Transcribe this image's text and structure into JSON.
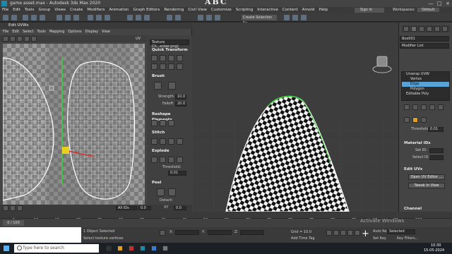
{
  "titlebar": {
    "title": "game asset.max - Autodesk 3ds Max 2020",
    "overlay_letters": "ABC",
    "min": "—",
    "max": "□",
    "close": "×"
  },
  "menu": [
    "File",
    "Edit",
    "Tools",
    "Group",
    "Views",
    "Create",
    "Modifiers",
    "Animation",
    "Graph Editors",
    "Rendering",
    "Civil View",
    "Customize",
    "Scripting",
    "Interactive",
    "Content",
    "Arnold",
    "Help",
    "Sign In"
  ],
  "signin": "Sign In",
  "workspaces": {
    "label": "Workspaces:",
    "value": "Default"
  },
  "toolbar": {
    "selection_set": "Create Selection Se"
  },
  "uvw": {
    "title": "Edit UVWs",
    "menu": [
      "File",
      "Edit",
      "Select",
      "Tools",
      "Mapping",
      "Options",
      "Display",
      "View"
    ],
    "uv_label": "UV",
    "texture_dropdown": "Texture Ch...ecker.png)",
    "sections": {
      "quick_transform": "Quick Transform",
      "brush": "Brush",
      "reshape": "Reshape Elements",
      "stitch": "Stitch",
      "explode": "Explode",
      "peel": "Peel"
    },
    "strength_label": "Strength:",
    "strength_value": "10.0",
    "falloff_label": "Falloff:",
    "falloff_value": "20.0",
    "threshold_label": "Threshold:",
    "threshold_value": "0.01",
    "detach_label": "Detach",
    "bottom": {
      "all_ids": "All IDs",
      "xy": "XY",
      "u_value": "0.0",
      "v_value": "0.0"
    }
  },
  "command_panel": {
    "object_name": "Box001",
    "modifier_list": "Modifier List",
    "stack": [
      "Unwrap UVW",
      "Vertex",
      "Edge",
      "Polygon",
      "Editable Poly"
    ],
    "selected_index": 2,
    "threshold_label": "Threshold:",
    "threshold_value": "0.01",
    "material_ids": "Material IDs",
    "set_id": "Set ID:",
    "select_id": "Select ID:",
    "edit_uvs": "Edit UVs",
    "open_uv_editor": "Open UV Editor ...",
    "tweak_in_view": "Tweak In View",
    "channel": "Channel"
  },
  "timeline": {
    "ticks": [
      "5",
      "10",
      "15",
      "20",
      "25",
      "30",
      "35",
      "40",
      "45",
      "50",
      "55",
      "60",
      "65",
      "70",
      "75",
      "80",
      "85",
      "90",
      "95",
      "100"
    ],
    "frame_counter": "0 / 100"
  },
  "status": {
    "objects_selected": "1 Object Selected",
    "prompt": "Select texture vertices",
    "grid": "Grid = 10.0",
    "add_time_tag": "Add Time Tag",
    "auto_key": "Auto Key",
    "set_key": "Set Key",
    "selected": "Selected",
    "key_filters": "Key Filters...",
    "x_label": "X:",
    "y_label": "Y:",
    "z_label": "Z:"
  },
  "taskbar": {
    "search": "Type here to search",
    "time": "10:30",
    "date": "15-05-2024"
  },
  "watermark": "Activate Windows",
  "colors": {
    "selection_blue": "#5aa3d6",
    "uv_wire": "#e8e8e8",
    "gizmo_yellow": "#e8d11a",
    "gizmo_red": "#d63030",
    "gizmo_green": "#3bd13b"
  }
}
